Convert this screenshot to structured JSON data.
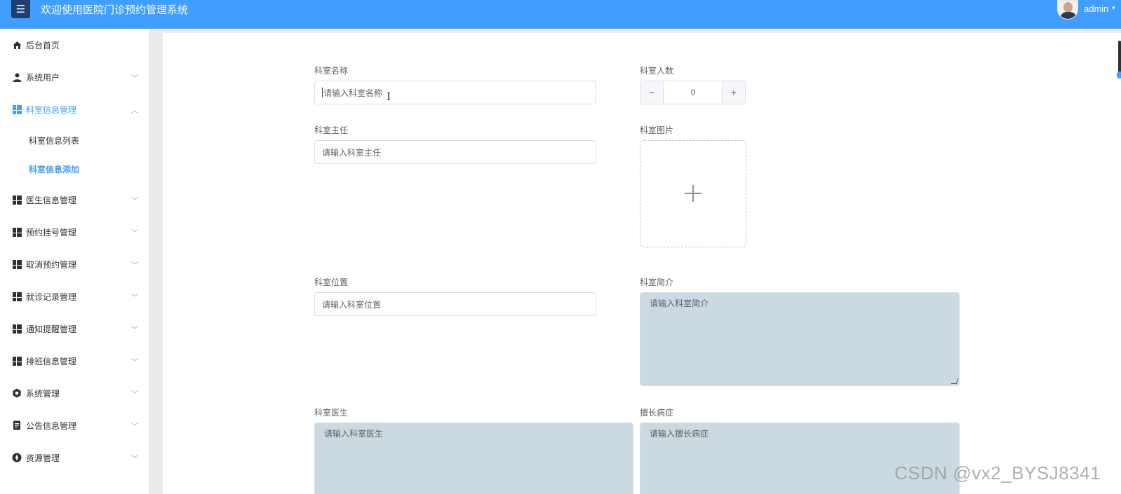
{
  "header": {
    "title": "欢迎使用医院门诊预约管理系统",
    "menu_icon": "hamburger-icon",
    "user_name": "admin",
    "user_caret": "▾",
    "brand_color": "#409eff"
  },
  "sidebar": {
    "items": [
      {
        "label": "后台首页",
        "icon": "home-icon"
      },
      {
        "label": "系统用户",
        "icon": "user-icon",
        "arrow": "﹀"
      },
      {
        "label": "科室信息管理",
        "icon": "grid-icon",
        "arrow": "︿",
        "expanded": true
      },
      {
        "label": "医生信息管理",
        "icon": "grid-icon",
        "arrow": "﹀"
      },
      {
        "label": "预约挂号管理",
        "icon": "grid-icon",
        "arrow": "﹀"
      },
      {
        "label": "取消预约管理",
        "icon": "grid-icon",
        "arrow": "﹀"
      },
      {
        "label": "就诊记录管理",
        "icon": "grid-icon",
        "arrow": "﹀"
      },
      {
        "label": "通知提醒管理",
        "icon": "grid-icon",
        "arrow": "﹀"
      },
      {
        "label": "排班信息管理",
        "icon": "grid-icon",
        "arrow": "﹀"
      },
      {
        "label": "系统管理",
        "icon": "gear-icon",
        "arrow": "﹀"
      },
      {
        "label": "公告信息管理",
        "icon": "document-icon",
        "arrow": "﹀"
      },
      {
        "label": "资源管理",
        "icon": "compass-icon",
        "arrow": "﹀"
      }
    ],
    "sub_items": [
      {
        "label": "科室信息列表"
      },
      {
        "label": "科室信息添加",
        "current": true
      }
    ]
  },
  "form": {
    "dept_name": {
      "label": "科室名称",
      "placeholder": "请输入科室名称"
    },
    "dept_count": {
      "label": "科室人数",
      "value": "0",
      "minus": "−",
      "plus": "+"
    },
    "dept_head": {
      "label": "科室主任",
      "placeholder": "请输入科室主任"
    },
    "dept_image": {
      "label": "科室图片"
    },
    "dept_location": {
      "label": "科室位置",
      "placeholder": "请输入科室位置"
    },
    "dept_intro": {
      "label": "科室简介",
      "placeholder": "请输入科室简介"
    },
    "dept_doctors": {
      "label": "科室医生",
      "placeholder": "请输入科室医生"
    },
    "specialty": {
      "label": "擅长病症",
      "placeholder": "请输入擅长病症"
    }
  },
  "watermark": "CSDN @vx2_BYSJ8341"
}
